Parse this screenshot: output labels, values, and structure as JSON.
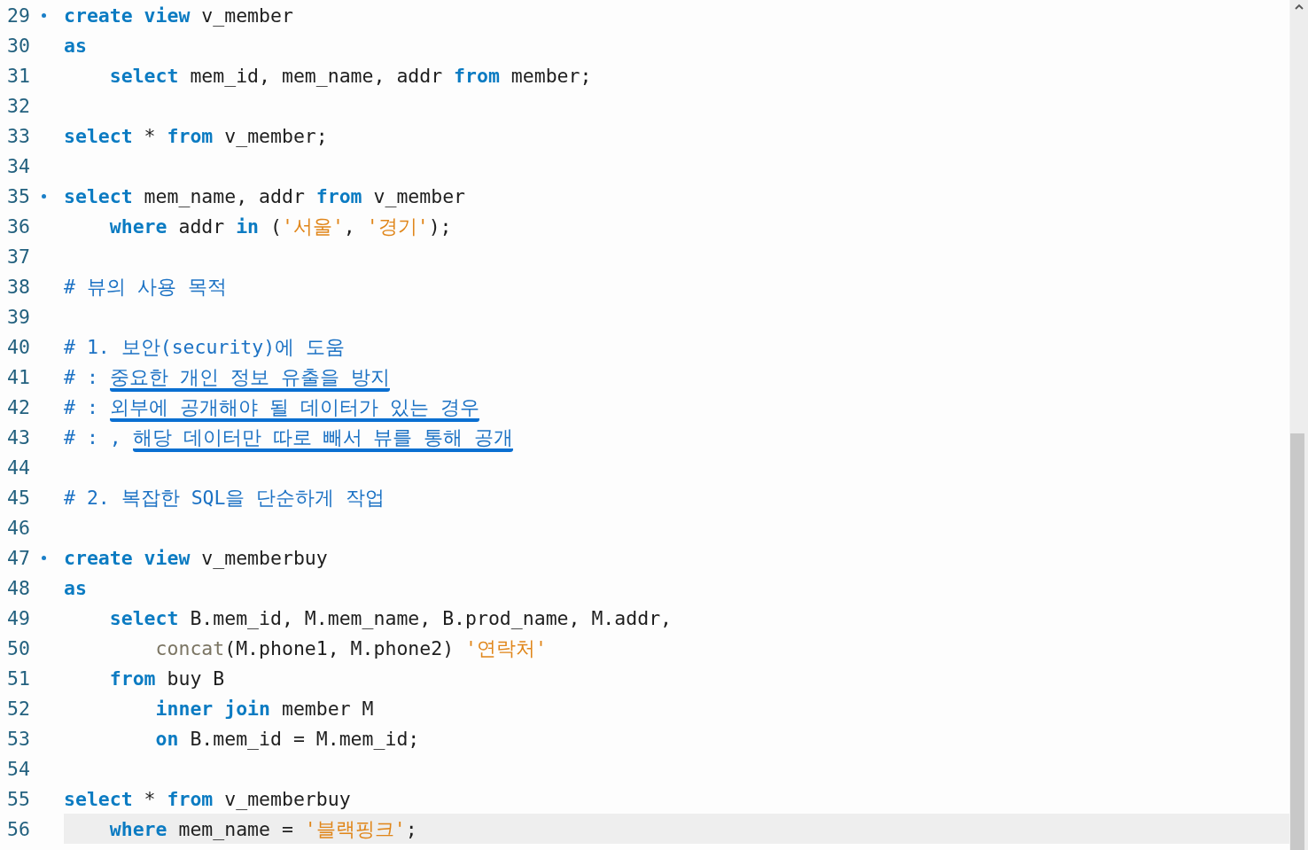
{
  "editor": {
    "lines": [
      {
        "number": "29",
        "fold_marker": true,
        "current": false,
        "tokens": [
          {
            "kind": "keyword",
            "text": "create view"
          },
          {
            "kind": "plain",
            "text": " v_member"
          }
        ]
      },
      {
        "number": "30",
        "fold_marker": false,
        "current": false,
        "tokens": [
          {
            "kind": "keyword",
            "text": "as"
          }
        ],
        "children": [
          {
            "number": "31",
            "fold_marker": false,
            "current": false,
            "tokens": [
              {
                "kind": "keyword",
                "text": "select"
              },
              {
                "kind": "plain",
                "text": " mem_id, mem_name, addr "
              },
              {
                "kind": "keyword",
                "text": "from"
              },
              {
                "kind": "plain",
                "text": " member;"
              }
            ]
          }
        ]
      },
      {
        "number": "32",
        "fold_marker": false,
        "current": false
      },
      {
        "number": "33",
        "fold_marker": false,
        "current": false,
        "tokens": [
          {
            "kind": "keyword",
            "text": "select"
          },
          {
            "kind": "plain",
            "text": " * "
          },
          {
            "kind": "keyword",
            "text": "from"
          },
          {
            "kind": "plain",
            "text": " v_member;"
          }
        ]
      },
      {
        "number": "34",
        "fold_marker": false,
        "current": false
      },
      {
        "number": "35",
        "fold_marker": true,
        "current": false,
        "tokens": [
          {
            "kind": "keyword",
            "text": "select"
          },
          {
            "kind": "plain",
            "text": " mem_name, addr "
          },
          {
            "kind": "keyword",
            "text": "from"
          },
          {
            "kind": "plain",
            "text": " v_member"
          }
        ],
        "children": [
          {
            "number": "36",
            "fold_marker": false,
            "current": false,
            "tokens": [
              {
                "kind": "keyword",
                "text": "where"
              },
              {
                "kind": "plain",
                "text": " addr "
              },
              {
                "kind": "keyword",
                "text": "in"
              },
              {
                "kind": "plain",
                "text": " ("
              },
              {
                "kind": "string",
                "text": "'서울'"
              },
              {
                "kind": "plain",
                "text": ", "
              },
              {
                "kind": "string",
                "text": "'경기'"
              },
              {
                "kind": "plain",
                "text": ");"
              }
            ]
          }
        ]
      },
      {
        "number": "37",
        "fold_marker": false,
        "current": false
      },
      {
        "number": "38",
        "fold_marker": false,
        "current": false,
        "tokens": [
          {
            "kind": "comment",
            "text": "# 뷰의 사용 목적"
          }
        ]
      },
      {
        "number": "39",
        "fold_marker": false,
        "current": false
      },
      {
        "number": "40",
        "fold_marker": false,
        "current": false,
        "tokens": [
          {
            "kind": "comment",
            "text": "# 1. 보안(security)에 도움"
          }
        ]
      },
      {
        "number": "41",
        "fold_marker": false,
        "current": false,
        "tokens": [
          {
            "kind": "comment",
            "text": "# : "
          },
          {
            "kind": "comment",
            "text": "중요한 개인 정보 유출을 방지",
            "underlined": true
          }
        ]
      },
      {
        "number": "42",
        "fold_marker": false,
        "current": false,
        "tokens": [
          {
            "kind": "comment",
            "text": "# : "
          },
          {
            "kind": "comment",
            "text": "외부에 공개해야 될 데이터가 있는 경우",
            "underlined": true
          }
        ]
      },
      {
        "number": "43",
        "fold_marker": false,
        "current": false,
        "tokens": [
          {
            "kind": "comment",
            "text": "# : , "
          },
          {
            "kind": "comment",
            "text": "해당 데이터만 따로 빼서 뷰를 통해 공개",
            "underlined": true
          }
        ]
      },
      {
        "number": "44",
        "fold_marker": false,
        "current": false
      },
      {
        "number": "45",
        "fold_marker": false,
        "current": false,
        "tokens": [
          {
            "kind": "comment",
            "text": "# 2. 복잡한 SQL을 단순하게 작업"
          }
        ]
      },
      {
        "number": "46",
        "fold_marker": false,
        "current": false
      },
      {
        "number": "47",
        "fold_marker": true,
        "current": false,
        "tokens": [
          {
            "kind": "keyword",
            "text": "create view"
          },
          {
            "kind": "plain",
            "text": " v_memberbuy"
          }
        ]
      },
      {
        "number": "48",
        "fold_marker": false,
        "current": false,
        "tokens": [
          {
            "kind": "keyword",
            "text": "as"
          }
        ],
        "children": [
          {
            "number": "49",
            "fold_marker": false,
            "current": false,
            "tokens": [
              {
                "kind": "keyword",
                "text": "select"
              },
              {
                "kind": "plain",
                "text": " B.mem_id, M.mem_name, B.prod_name, M.addr,"
              }
            ],
            "children": [
              {
                "number": "50",
                "fold_marker": false,
                "current": false,
                "tokens": [
                  {
                    "kind": "function",
                    "text": "concat"
                  },
                  {
                    "kind": "plain",
                    "text": "(M.phone1, M.phone2) "
                  },
                  {
                    "kind": "string",
                    "text": "'연락처'"
                  }
                ]
              }
            ]
          },
          {
            "number": "51",
            "fold_marker": false,
            "current": false,
            "tokens": [
              {
                "kind": "keyword",
                "text": "from"
              },
              {
                "kind": "plain",
                "text": " buy B"
              }
            ],
            "children": [
              {
                "number": "52",
                "fold_marker": false,
                "current": false,
                "tokens": [
                  {
                    "kind": "keyword",
                    "text": "inner join"
                  },
                  {
                    "kind": "plain",
                    "text": " member M"
                  }
                ]
              },
              {
                "number": "53",
                "fold_marker": false,
                "current": false,
                "tokens": [
                  {
                    "kind": "keyword",
                    "text": "on"
                  },
                  {
                    "kind": "plain",
                    "text": " B.mem_id = M.mem_id;"
                  }
                ]
              }
            ]
          }
        ]
      },
      {
        "number": "54",
        "fold_marker": false,
        "current": false
      },
      {
        "number": "55",
        "fold_marker": false,
        "current": false,
        "tokens": [
          {
            "kind": "keyword",
            "text": "select"
          },
          {
            "kind": "plain",
            "text": " * "
          },
          {
            "kind": "keyword",
            "text": "from"
          },
          {
            "kind": "plain",
            "text": " v_memberbuy"
          }
        ],
        "children": [
          {
            "number": "56",
            "fold_marker": false,
            "current": true,
            "tokens": [
              {
                "kind": "keyword",
                "text": "where"
              },
              {
                "kind": "plain",
                "text": " mem_name = "
              },
              {
                "kind": "string",
                "text": "'블랙핑크'"
              },
              {
                "kind": "plain",
                "text": ";"
              }
            ]
          }
        ]
      }
    ]
  }
}
